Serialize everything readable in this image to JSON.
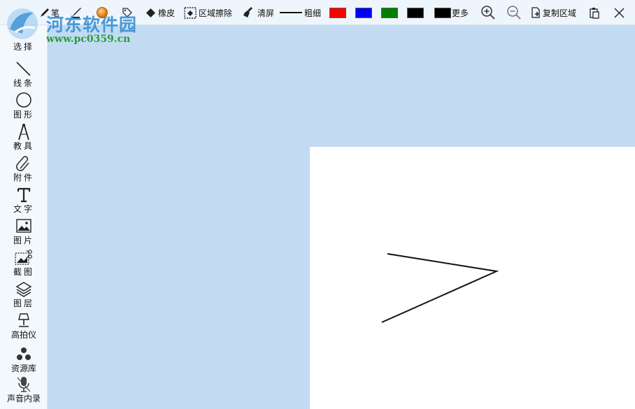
{
  "watermark": {
    "title": "河东软件园",
    "url": "www.pc0359.cn"
  },
  "toolbar": {
    "pen_label": "笔",
    "eraser_label": "橡皮",
    "area_erase_label": "区域擦除",
    "clear_label": "清屏",
    "thickness_label": "粗细",
    "more_label": "更多",
    "copy_area_label": "复制区域",
    "colors": [
      "#ff0000",
      "#0000ff",
      "#008000",
      "#000000",
      "#000000"
    ]
  },
  "sidebar": {
    "items": [
      {
        "label": "选择",
        "icon": "cursor-icon"
      },
      {
        "label": "线条",
        "icon": "line-icon"
      },
      {
        "label": "图形",
        "icon": "circle-icon"
      },
      {
        "label": "教具",
        "icon": "compass-icon"
      },
      {
        "label": "附件",
        "icon": "paperclip-icon"
      },
      {
        "label": "文字",
        "icon": "text-icon"
      },
      {
        "label": "图片",
        "icon": "image-icon"
      },
      {
        "label": "截图",
        "icon": "screenshot-icon"
      },
      {
        "label": "图层",
        "icon": "layers-icon"
      },
      {
        "label": "高拍仪",
        "icon": "document-camera-icon"
      },
      {
        "label": "资源库",
        "icon": "resource-icon"
      },
      {
        "label": "声音内录",
        "icon": "microphone-icon"
      }
    ]
  }
}
